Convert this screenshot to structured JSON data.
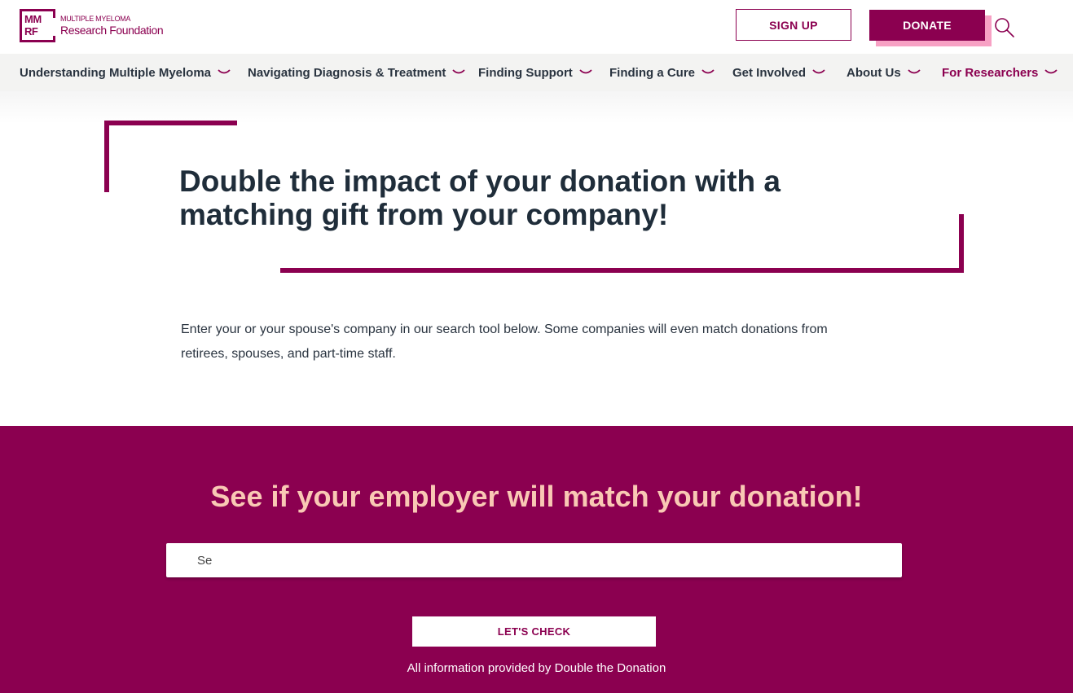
{
  "header": {
    "logo": {
      "mark_line1": "MM",
      "mark_line2": "RF",
      "small_text": "MULTIPLE MYELOMA",
      "name": "Research Foundation"
    },
    "signup_label": "SIGN UP",
    "donate_label": "DONATE",
    "search_icon": "search-icon"
  },
  "nav": {
    "items": [
      {
        "label": "Understanding Multiple Myeloma"
      },
      {
        "label": "Navigating Diagnosis & Treatment"
      },
      {
        "label": "Finding Support"
      },
      {
        "label": "Finding a Cure"
      },
      {
        "label": "Get Involved"
      },
      {
        "label": "About Us"
      },
      {
        "label": "For Researchers"
      }
    ]
  },
  "hero": {
    "title": "Double the impact of your donation with a matching gift from your company!",
    "body": "Enter your or your spouse's company in our search tool below. Some companies will even match donations from retirees, spouses, and part-time staff."
  },
  "match": {
    "title": "See if your employer will match your donation!",
    "search_value": "Se",
    "button_label": "LET'S CHECK",
    "attribution": "All information provided by Double the Donation"
  },
  "colors": {
    "brand": "#8b0050",
    "brand_shadow": "#f7a1c4",
    "match_title": "#f9c8b4",
    "nav_bg": "#f3f3f2",
    "text_dark": "#1f2d3a"
  }
}
